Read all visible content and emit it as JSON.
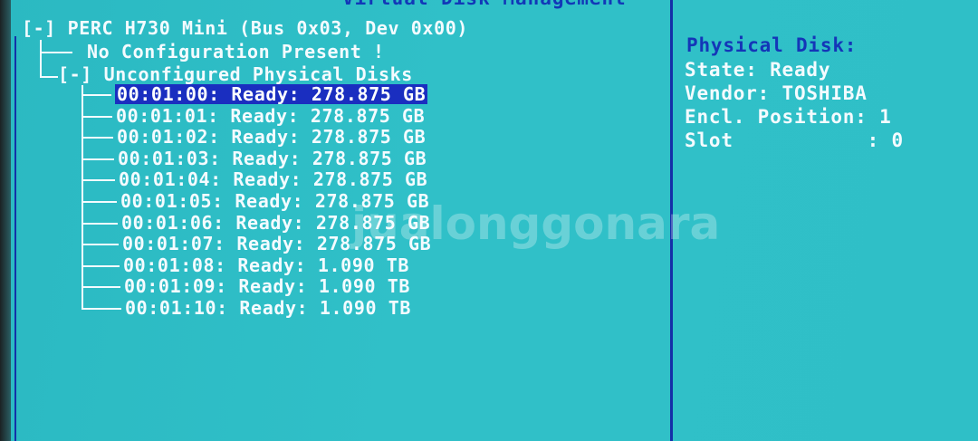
{
  "header": {
    "title": "Virtual Disk Management"
  },
  "tree": {
    "controller": "[-] PERC H730 Mini (Bus 0x03, Dev 0x00)",
    "no_config": "No Configuration Present !",
    "unconfigured": "[-] Unconfigured Physical Disks",
    "disks": [
      {
        "label": "00:01:00: Ready: 278.875 GB",
        "selected": true
      },
      {
        "label": "00:01:01: Ready: 278.875 GB",
        "selected": false
      },
      {
        "label": "00:01:02: Ready: 278.875 GB",
        "selected": false
      },
      {
        "label": "00:01:03: Ready: 278.875 GB",
        "selected": false
      },
      {
        "label": "00:01:04: Ready: 278.875 GB",
        "selected": false
      },
      {
        "label": "00:01:05: Ready: 278.875 GB",
        "selected": false
      },
      {
        "label": "00:01:06: Ready: 278.875 GB",
        "selected": false
      },
      {
        "label": "00:01:07: Ready: 278.875 GB",
        "selected": false
      },
      {
        "label": "00:01:08: Ready: 1.090 TB",
        "selected": false
      },
      {
        "label": "00:01:09: Ready: 1.090 TB",
        "selected": false
      },
      {
        "label": "00:01:10: Ready: 1.090 TB",
        "selected": false
      }
    ]
  },
  "details": {
    "title": "Physical Disk:",
    "state": "State: Ready",
    "vendor": "Vendor: TOSHIBA",
    "encl_position": "Encl. Position: 1",
    "slot": "Slot           : 0"
  },
  "watermark": "jualonggonara",
  "colors": {
    "background": "#2fbfc7",
    "highlight": "#1a2ec0",
    "title_blue": "#1436b8",
    "text_white": "#f4fbff"
  }
}
